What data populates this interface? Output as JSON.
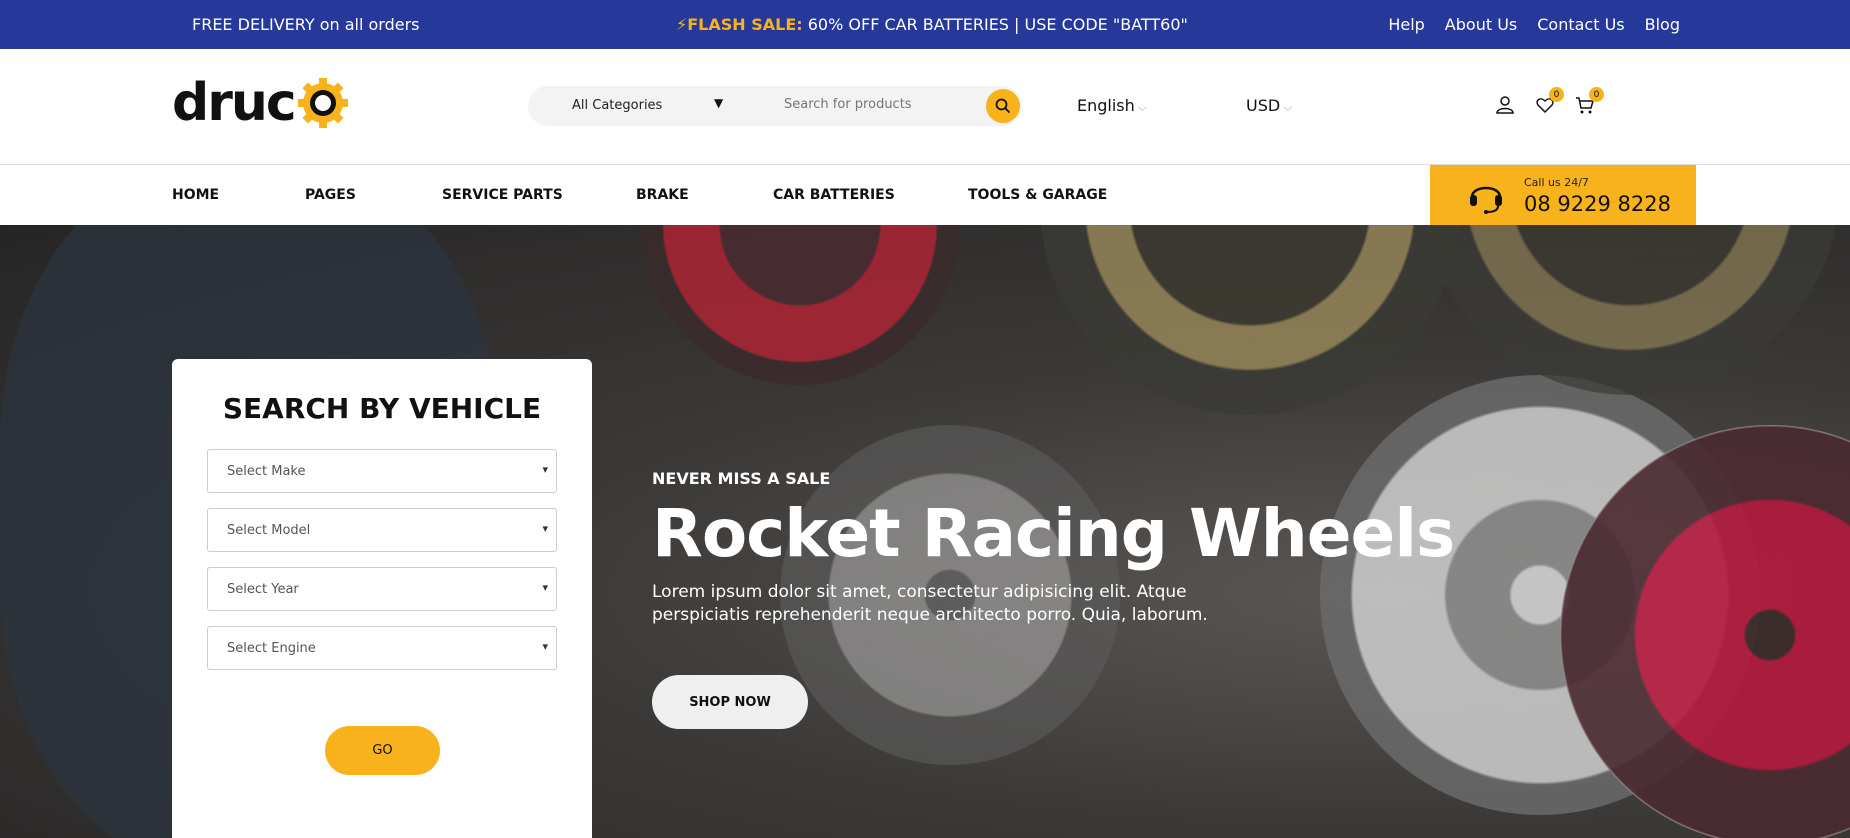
{
  "topbar": {
    "free_delivery": "FREE DELIVERY on all orders",
    "flash_label": "FLASH SALE:",
    "flash_text": "60% OFF CAR BATTERIES | USE CODE \"BATT60\"",
    "links": [
      "Help",
      "About Us",
      "Contact Us",
      "Blog"
    ]
  },
  "header": {
    "logo_text": "druc",
    "search": {
      "category": "All Categories",
      "placeholder": "Search for products"
    },
    "language": "English",
    "currency": "USD",
    "wishlist_count": "0",
    "cart_count": "0"
  },
  "nav": {
    "items": [
      "HOME",
      "PAGES",
      "SERVICE PARTS",
      "BRAKE",
      "CAR BATTERIES",
      "TOOLS & GARAGE"
    ],
    "call_label": "Call us 24/7",
    "call_number": "08 9229 8228"
  },
  "vehicle_search": {
    "title": "SEARCH BY VEHICLE",
    "selects": [
      "Select Make",
      "Select Model",
      "Select Year",
      "Select Engine"
    ],
    "go_label": "GO"
  },
  "hero": {
    "kicker": "NEVER MISS A SALE",
    "title": "Rocket Racing Wheels",
    "description": "Lorem ipsum dolor sit amet, consectetur adipisicing elit. Atque perspiciatis reprehenderit neque architecto porro. Quia, laborum.",
    "cta": "SHOP NOW"
  },
  "colors": {
    "brand_blue": "#26399a",
    "accent_yellow": "#f7b21c"
  }
}
